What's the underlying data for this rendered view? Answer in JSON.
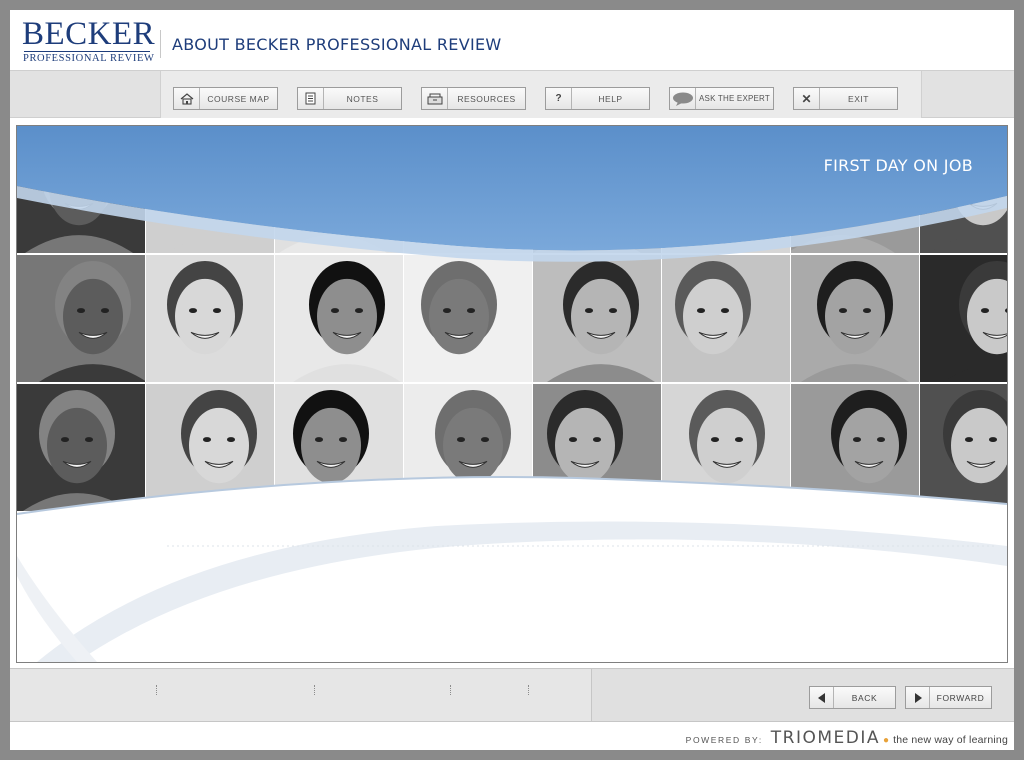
{
  "header": {
    "logo_main": "BECKER",
    "logo_sub": "PROFESSIONAL REVIEW",
    "title": "ABOUT BECKER PROFESSIONAL REVIEW"
  },
  "toolbar": {
    "buttons": [
      {
        "label": "COURSE MAP",
        "icon": "house-icon"
      },
      {
        "label": "NOTES",
        "icon": "document-icon"
      },
      {
        "label": "RESOURCES",
        "icon": "filebox-icon"
      },
      {
        "label": "HELP",
        "icon": "question-icon"
      },
      {
        "label": "ASK THE EXPERT",
        "icon": "speech-bubble-icon"
      },
      {
        "label": "EXIT",
        "icon": "close-icon"
      }
    ]
  },
  "slide": {
    "title": "FIRST DAY ON JOB"
  },
  "navigation": {
    "back_label": "BACK",
    "forward_label": "FORWARD"
  },
  "footer": {
    "powered_label": "POWERED BY:",
    "brand": "TRIOMEDIA",
    "tagline": "the new way of learning"
  },
  "colors": {
    "brand_blue": "#1e3d7b",
    "banner_blue": "#6a9ad0",
    "accent_orange": "#e8a23a"
  }
}
